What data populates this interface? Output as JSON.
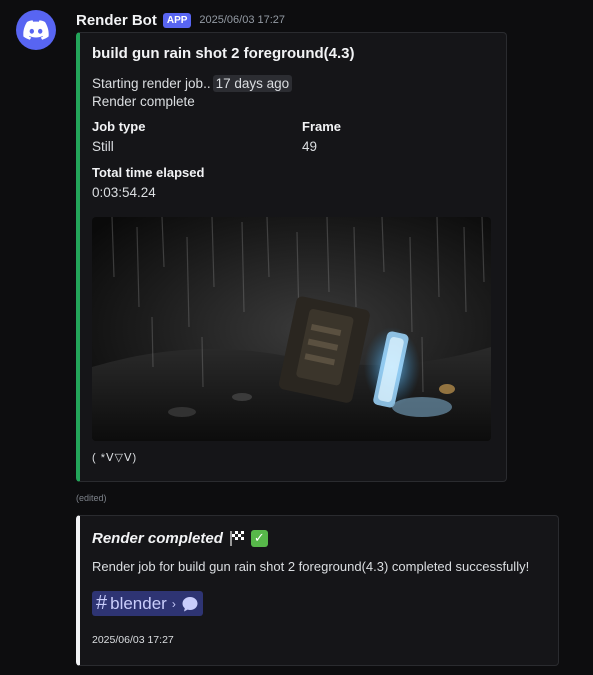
{
  "message": {
    "username": "Render Bot",
    "badge": "APP",
    "timestamp": "2025/06/03 17:27",
    "edited_label": "(edited)"
  },
  "embed1": {
    "accent_color": "#23a55a",
    "title": "build gun rain shot 2 foreground(4.3)",
    "desc_prefix": "Starting render job..",
    "desc_relative_time": "17 days ago",
    "desc_line2": "Render complete",
    "fields": [
      {
        "name": "Job type",
        "value": "Still"
      },
      {
        "name": "Frame",
        "value": "49"
      },
      {
        "name": "Total time elapsed",
        "value": "0:03:54.24"
      }
    ],
    "footer": "( *ᐯ▽ᐯ)"
  },
  "embed2": {
    "accent_color": "#f2f3f5",
    "title": "Render completed",
    "title_icons": [
      "checkered-flag-icon",
      "check-mark-icon"
    ],
    "description": "Render job for build gun rain shot 2 foreground(4.3) completed successfully!",
    "channel_name": "blender",
    "timestamp": "2025/06/03 17:27"
  }
}
